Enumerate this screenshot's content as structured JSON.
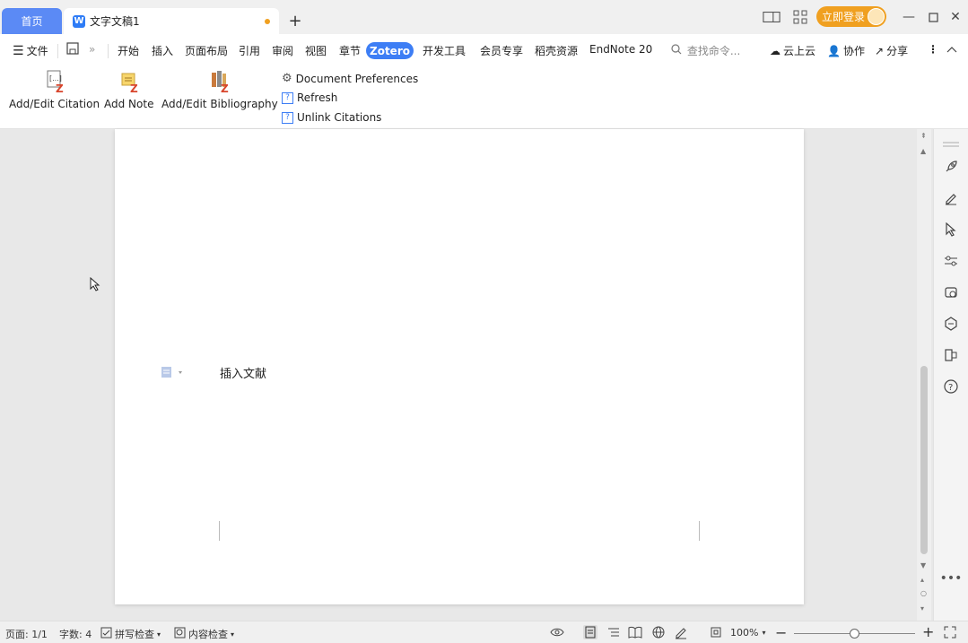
{
  "titlebar": {
    "home_tab": "首页",
    "doc_tab": "文字文稿1",
    "new_tab": "+",
    "login_button": "立即登录",
    "icons": [
      "layout-icon",
      "grid-icon",
      "minimize-icon",
      "maximize-icon",
      "close-icon"
    ]
  },
  "menubar": {
    "file": "文件",
    "more": "»",
    "items": [
      "开始",
      "插入",
      "页面布局",
      "引用",
      "审阅",
      "视图",
      "章节",
      "Zotero",
      "开发工具",
      "会员专享",
      "稻壳资源",
      "EndNote 20"
    ],
    "search_placeholder": "查找命令...",
    "cloud": "云上云",
    "collab": "协作",
    "share": "分享"
  },
  "ribbon": {
    "add_edit_citation": "Add/Edit Citation",
    "add_note": "Add Note",
    "add_edit_bibliography": "Add/Edit Bibliography",
    "document_preferences": "Document Preferences",
    "refresh": "Refresh",
    "unlink_citations": "Unlink Citations"
  },
  "document": {
    "body_text": "插入文献"
  },
  "statusbar": {
    "page": "页面: 1/1",
    "word_count": "字数: 4",
    "spell_check": "拼写检查",
    "content_check": "内容检查",
    "zoom": "100%",
    "zoom_level": 0.5
  },
  "colors": {
    "accent": "#3d7ef5",
    "home_tab": "#5b8af5",
    "login": "#f0a020"
  }
}
